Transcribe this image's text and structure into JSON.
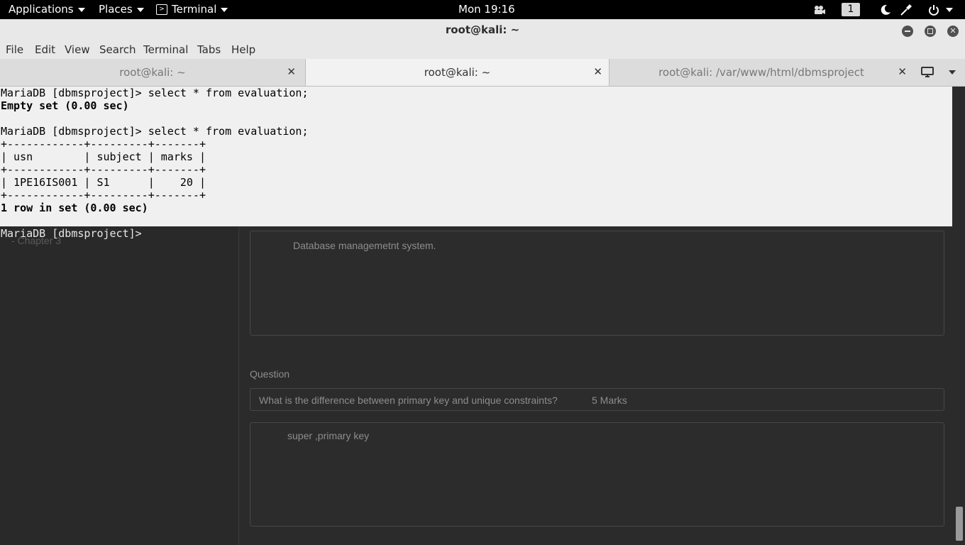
{
  "topbar": {
    "applications": "Applications",
    "places": "Places",
    "terminal": "Terminal",
    "clock": "Mon 19:16",
    "workspace": "1"
  },
  "window": {
    "title": "root@kali: ~"
  },
  "menu": [
    "File",
    "Edit",
    "View",
    "Search",
    "Terminal",
    "Tabs",
    "Help"
  ],
  "tabs": [
    {
      "label": "root@kali: ~"
    },
    {
      "label": "root@kali: ~"
    },
    {
      "label": "root@kali: /var/www/html/dbmsproject"
    }
  ],
  "terminal": {
    "lines": [
      {
        "text": "MariaDB [dbmsproject]> select * from evaluation;",
        "bold": false
      },
      {
        "text": "Empty set (0.00 sec)",
        "bold": true
      },
      {
        "text": "",
        "bold": false
      },
      {
        "text": "MariaDB [dbmsproject]> select * from evaluation;",
        "bold": false
      },
      {
        "text": "+------------+---------+-------+",
        "bold": false
      },
      {
        "text": "| usn        | subject | marks |",
        "bold": false
      },
      {
        "text": "+------------+---------+-------+",
        "bold": false
      },
      {
        "text": "| 1PE16IS001 | S1      |    20 |",
        "bold": false
      },
      {
        "text": "+------------+---------+-------+",
        "bold": false
      },
      {
        "text": "1 row in set (0.00 sec)",
        "bold": true
      }
    ],
    "prompt": "MariaDB [dbmsproject]> "
  },
  "background_page": {
    "sidebar_item": "- Chapter 3",
    "answer1": "Database managemetnt system.",
    "question_label": "Question",
    "question_text": "What is the difference between primary key and unique constraints?",
    "question_marks": "5 Marks",
    "answer2": "super ,primary key"
  }
}
